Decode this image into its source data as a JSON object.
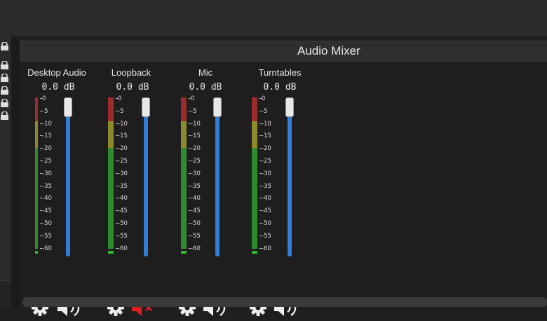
{
  "panel": {
    "title": "Audio Mixer"
  },
  "channels": [
    {
      "name": "Desktop Audio",
      "volume": "0.0 dB",
      "muted": false
    },
    {
      "name": "Loopback",
      "volume": "0.0 dB",
      "muted": true
    },
    {
      "name": "Mic",
      "volume": "0.0 dB",
      "muted": false
    },
    {
      "name": "Turntables",
      "volume": "0.0 dB",
      "muted": false
    }
  ],
  "meter_scale": [
    "0",
    "-5",
    "-10",
    "-15",
    "-20",
    "-25",
    "-30",
    "-35",
    "-40",
    "-45",
    "-50",
    "-55",
    "-60"
  ],
  "icons": {
    "settings": "gear-icon",
    "volume": "speaker-icon",
    "muted": "speaker-muted-icon",
    "lock": "lock-icon"
  },
  "colors": {
    "meter_red": "#9c2b2b",
    "meter_yellow": "#8c8a2c",
    "meter_green": "#2e8b2e",
    "slider_track": "#2f7fd6",
    "mute_red": "#e02020"
  }
}
